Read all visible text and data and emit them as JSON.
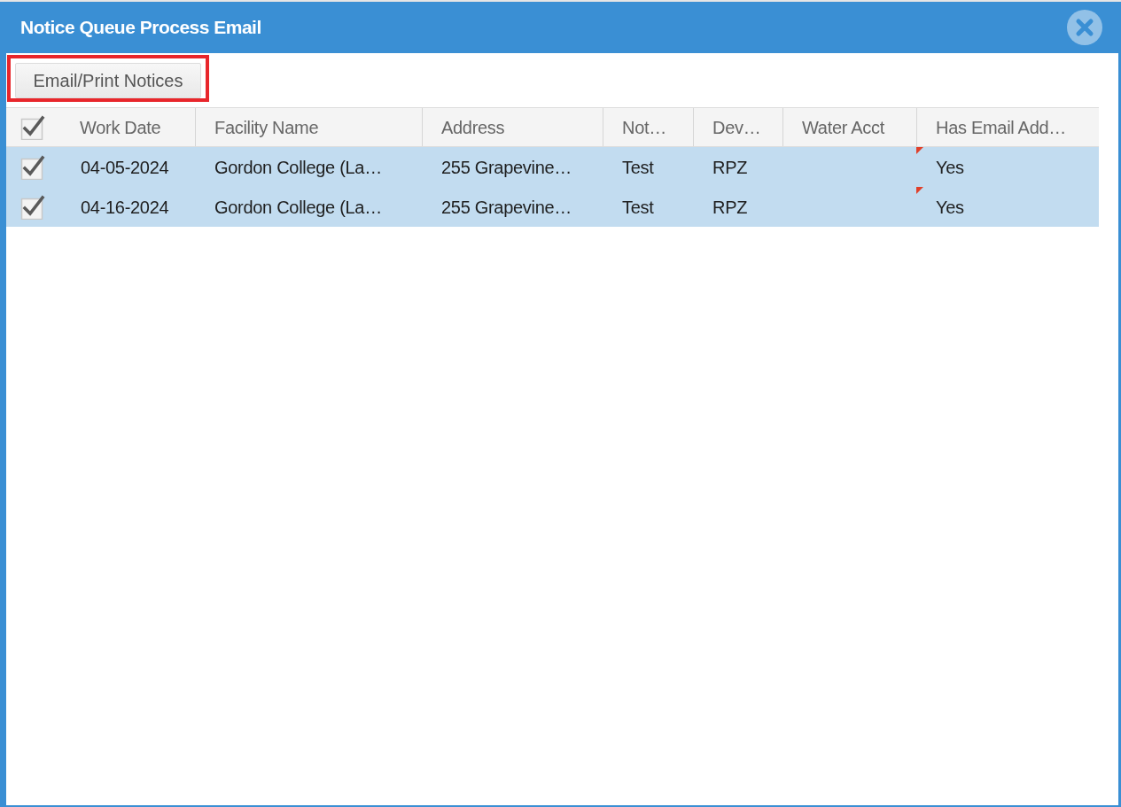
{
  "window": {
    "title": "Notice Queue Process Email"
  },
  "toolbar": {
    "button": {
      "label": "Email/Print Notices",
      "highlighted": true
    }
  },
  "table": {
    "header_checkbox": {
      "checked": true
    },
    "columns": [
      "Work Date",
      "Facility Name",
      "Address",
      "Not…",
      "Dev…",
      "Water Acct",
      "Has Email Add…"
    ],
    "rows": [
      {
        "selected": true,
        "checked": true,
        "email_edited": true,
        "cells": {
          "work_date": "04-05-2024",
          "facility_name": "Gordon College (La…",
          "address": "255 Grapevine…",
          "column_5": "Test",
          "column_6": "RPZ",
          "has_email_add": "Yes"
        }
      },
      {
        "selected": true,
        "checked": true,
        "email_edited": true,
        "cells": {
          "work_date": "04-16-2024",
          "facility_name": "Gordon College (La…",
          "address": "255 Grapevine…",
          "column_5": "Test",
          "column_6": "RPZ",
          "has_email_add": "Yes"
        }
      }
    ]
  }
}
